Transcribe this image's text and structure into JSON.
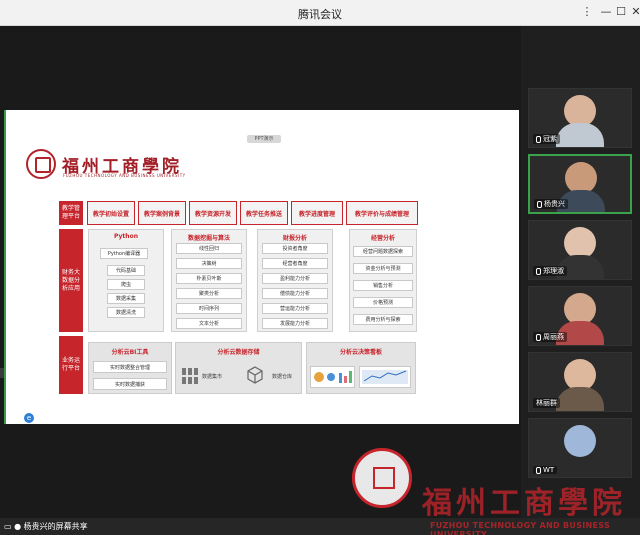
{
  "window": {
    "title": "腾讯会议"
  },
  "slide": {
    "tab_label": "PPT演示",
    "school_cn": "福州工商學院",
    "school_en": "FUZHOU TECHNOLOGY AND BUSINESS UNIVERSITY",
    "row_labels": [
      "教学管理平台",
      "财务大数据分析应用",
      "业务运行平台"
    ],
    "top_tabs": [
      "教学初始设置",
      "教学案例背景",
      "教学资源开发",
      "教学任务推送",
      "教学进度管理",
      "教学评价与成绩管理"
    ],
    "columns": [
      {
        "title": "Python",
        "items": [
          "Python编译器",
          "代码基础",
          "爬虫",
          "数据采集",
          "数据清洗"
        ]
      },
      {
        "title": "数据挖掘与算法",
        "items": [
          "线性回归",
          "决策树",
          "朴素贝叶斯",
          "聚类分析",
          "时间序列",
          "文本分析"
        ]
      },
      {
        "title": "财报分析",
        "items": [
          "投资者角度",
          "经营者角度",
          "盈利能力分析",
          "偿债能力分析",
          "营运能力分析",
          "发展能力分析"
        ]
      },
      {
        "title": "经营分析",
        "items": [
          "经营问题数据探索",
          "资金分析与预测",
          "销售分析",
          "价格预测",
          "费用分析与探索"
        ]
      }
    ],
    "bottom": [
      {
        "title": "分析云BI工具",
        "items": [
          "实时数据整合管理",
          "实时数据捕获"
        ]
      },
      {
        "title": "分析云数据存储",
        "items": [
          "数据集市",
          "数据仓库"
        ]
      },
      {
        "title": "分析云决策看板",
        "items": []
      }
    ]
  },
  "participants": [
    {
      "name": "冠紫",
      "active": false
    },
    {
      "name": "杨贵兴",
      "active": true
    },
    {
      "name": "郑理淑",
      "active": false
    },
    {
      "name": "周丽燕",
      "active": false
    },
    {
      "name": "林丽群",
      "active": false
    },
    {
      "name": "WT",
      "active": false
    }
  ],
  "status": {
    "share_text": "杨贵兴的屏幕共享"
  },
  "watermark": {
    "cn": "福州工商學院",
    "en": "FUZHOU TECHNOLOGY AND BUSINESS UNIVERSITY"
  },
  "icons": {
    "minimize": "minimize-icon",
    "maximize": "maximize-icon",
    "close": "close-icon"
  },
  "colors": {
    "accent": "#c7252c",
    "active_border": "#3aa24a"
  }
}
